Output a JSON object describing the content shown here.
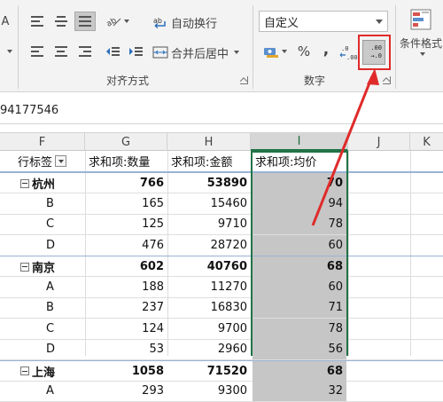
{
  "ribbon": {
    "wrap_text": "自动换行",
    "merge_center": "合并后居中",
    "alignment_group": "对齐方式",
    "number_group": "数字",
    "number_format": "自定义",
    "percent": "%",
    "comma": ",",
    "cond_format": "条件格式",
    "dec_top": ".00",
    "dec_bottom": "→.0",
    "left_frag": "A"
  },
  "formula_bar": {
    "value": "94177546"
  },
  "columns": [
    "F",
    "G",
    "H",
    "I",
    "J",
    "K"
  ],
  "selected_column": "I",
  "pivot": {
    "headers": [
      "行标签",
      "求和项:数量",
      "求和项:金额",
      "求和项:均价"
    ],
    "rows": [
      {
        "label": "杭州",
        "group": true,
        "qty": "766",
        "amount": "53890",
        "avg": "70"
      },
      {
        "label": "B",
        "group": false,
        "qty": "165",
        "amount": "15460",
        "avg": "94"
      },
      {
        "label": "C",
        "group": false,
        "qty": "125",
        "amount": "9710",
        "avg": "78"
      },
      {
        "label": "D",
        "group": false,
        "qty": "476",
        "amount": "28720",
        "avg": "60"
      },
      {
        "label": "南京",
        "group": true,
        "qty": "602",
        "amount": "40760",
        "avg": "68"
      },
      {
        "label": "A",
        "group": false,
        "qty": "188",
        "amount": "11270",
        "avg": "60"
      },
      {
        "label": "B",
        "group": false,
        "qty": "237",
        "amount": "16830",
        "avg": "71"
      },
      {
        "label": "C",
        "group": false,
        "qty": "124",
        "amount": "9700",
        "avg": "78"
      },
      {
        "label": "D",
        "group": false,
        "qty": "53",
        "amount": "2960",
        "avg": "56"
      },
      {
        "label": "上海",
        "group": true,
        "qty": "1058",
        "amount": "71520",
        "avg": "68"
      },
      {
        "label": "A",
        "group": false,
        "qty": "293",
        "amount": "9300",
        "avg": "32"
      }
    ]
  },
  "colors": {
    "selection": "#217346",
    "annotation": "#e02a2a",
    "avg_fill": "#c6c6c6"
  }
}
